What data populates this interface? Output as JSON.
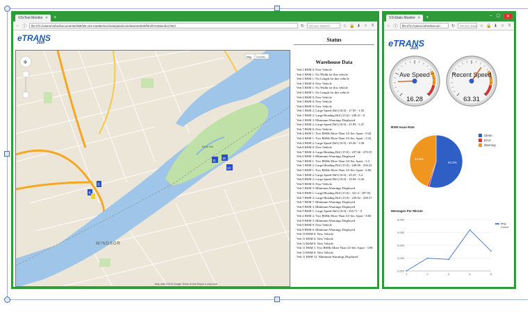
{
  "left_window": {
    "tab_title": "V2xTest Monitor",
    "url": "file:///C:/Users/John/Documents/SMI/eB-v2x-master/src/main/java/com/etrans2020/html/V2xMonitor.html",
    "search_placeholder": "Secure Search",
    "logo_text": "eTRANS",
    "logo_year": "2020",
    "status_heading": "Status",
    "warehouse_heading": "Warehouse Data",
    "map_type_buttons": [
      "Map",
      "Satellite"
    ],
    "map_label_city": "WINDSOR",
    "map_label_island": "Belle Isle",
    "map_footer": "Map data ©2016 Google   Terms of Use   Report a map error",
    "map_markers": [
      "5",
      "4",
      "11",
      "16",
      "13"
    ],
    "log_lines": [
      "Veh 2 BSM 0: New Vehicle",
      "Veh 2 BSM 1: No Width for this vehicle",
      "Veh 2 BSM 1: No Length for this vehicle",
      "Veh 3 BSM 0: New Vehicle",
      "Veh 3 BSM 1: No Width for this vehicle",
      "Veh 3 BSM 1: No Length for this vehicle",
      "Veh 4 BSM 0: New Vehicle",
      "Veh 5 BSM 0: New Vehicle",
      "Veh 6 BSM 0: New Vehicle",
      "Veh 1 BSM 2: Large Speed Diff (10.0) - 17.95 - 1.92",
      "Veh 1 BSM 2: Large Heading Diff (15.0) - 249.21 - 0",
      "Veh 2 BSM 3: Minimum Warnings Displayed",
      "Veh 2 BSM 2: Large Speed Diff (10.0) - 25.99 - 3.47",
      "Veh 7 BSM 0: New Vehicle",
      "Veh 4 BSM 1: Two BSMs More Than 3.0 Sec Apart - 8.44",
      "Veh 4 BSM 1: Two BSMs More Than 3.0 Sec Apart - 4.32",
      "Veh 4 BSM 2: Large Speed Diff (10.0) - 29.26 - 3.38",
      "Veh 8 BSM 0: New Vehicle",
      "Veh 7 BSM 4: Large Heading Diff (15.0) - 237.66 - 270.55",
      "Veh 6 BSM 3: Minimum Warnings Displayed",
      "Veh 5 BSM 1: Two BSMs More Than 3.0 Sec Apart - 5.3",
      "Veh 1 BSM 2: Large Heading Diff (15.0) - 240.09 - 256.52",
      "Veh 5 BSM 1: Two BSMs More Than 3.0 Sec Apart - 6.06",
      "Veh 1 BSM 2: Large Speed Diff (10.0) - 29.23 - 3.4",
      "Veh 8 BSM 2: Large Speed Diff (10.0) - 18.94 - 6.42",
      "Veh 9 BSM 0: New Vehicle",
      "Veh 5 BSM 3: Minimum Warnings Displayed",
      "Veh 9 BSM 1: Large Heading Diff (15.0) - 321.4 - 297.93",
      "Veh 7 BSM 2: Large Heading Diff (15.0) - 239.02 - 258.57",
      "Veh 7 BSM 7: Minimum Warnings Displayed",
      "Veh 9 BSM 3: Minimum Warnings Displayed",
      "Veh 9 BSM 1: Large Speed Diff (10.0) - 255.71 - 0",
      "Veh 4 BSM 2: Two BSMs More Than 3.0 Sec Apart - 8.06",
      "Veh 8 BSM 3: Minimum Warnings Displayed",
      "Veh 9 BSM 9: New Vehicle",
      "Veh 8 BSM 6: Minimum Warnings Displayed",
      "Veh 10 BSM 0: New Vehicle",
      "Veh 11 BSM 0: New Vehicle",
      "Veh 12 BSM 0: New Vehicle",
      "Veh 11 BSM 1: Two BSMs More Than 3.0 Sec Apart - 3.98",
      "Veh 13 BSM 0: New Vehicle",
      "Veh 11 BSM 12: Minimum Warnings Displayed"
    ]
  },
  "right_window": {
    "tab_title": "V2xStats Monitor",
    "url": "file:///C:/Users/John/Docum",
    "search_placeholder": "Secure Sear",
    "logo_text": "eTRANS",
    "logo_year": "2020",
    "gauge1": {
      "label": "Ave Speed",
      "value": "16.28",
      "fraction": 0.16
    },
    "gauge2": {
      "label": "Recent Speed",
      "value": "63.31",
      "fraction": 0.63
    },
    "pie": {
      "title": "BSM Issue Rate",
      "legend": [
        "Clean",
        "Error",
        "Warning"
      ],
      "colors": [
        "#2f5fc4",
        "#d33a2c",
        "#f0961e"
      ],
      "labels": [
        "54.3%",
        "44.6%"
      ]
    }
  },
  "chart_data": {
    "type": "line",
    "title": "Messages Per Minute",
    "series": [
      {
        "name": "Msg Count",
        "values": [
          2000,
          3000,
          2900,
          5200,
          3550
        ]
      }
    ],
    "x": [
      1,
      2,
      3,
      4,
      5
    ],
    "ylim": [
      2000,
      6000
    ],
    "yticks": [
      "6,000",
      "5,000",
      "4,000",
      "3,000",
      "2,000"
    ],
    "xticks": [
      "1",
      "2",
      "3",
      "4",
      "5"
    ],
    "color": "#4f7fc9"
  }
}
